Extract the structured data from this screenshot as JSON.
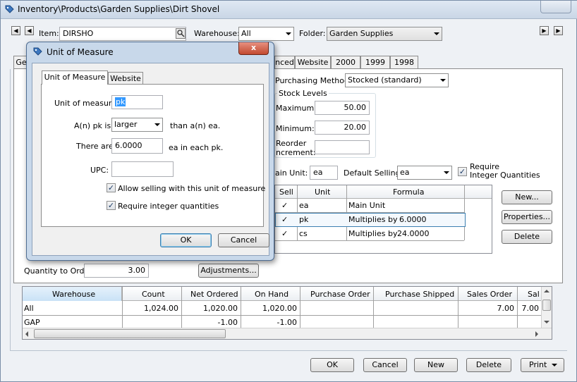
{
  "window": {
    "title": "Inventory\\Products\\Garden Supplies\\Dirt Shovel"
  },
  "header": {
    "item_label": "Item:",
    "item_value": "DIRSHO",
    "warehouse_label": "Warehouse:",
    "warehouse_value": "All",
    "folder_label": "Folder:",
    "folder_value": "Garden Supplies"
  },
  "tabs": [
    {
      "label": "Ge"
    },
    {
      "label": "nced"
    },
    {
      "label": "Website"
    },
    {
      "label": "2000"
    },
    {
      "label": "1999"
    },
    {
      "label": "1998"
    }
  ],
  "purchasing": {
    "method_label": "Purchasing Method:",
    "method_value": "Stocked (standard)"
  },
  "stock_levels": {
    "title": "Stock Levels",
    "maximum_label": "Maximum:",
    "maximum_value": "50.00",
    "minimum_label": "Minimum:",
    "minimum_value": "20.00",
    "reorder_label_1": "Reorder",
    "reorder_label_2": "ncrement:",
    "reorder_value": ""
  },
  "units": {
    "main_unit_label": "ain Unit:",
    "main_unit_value": "ea",
    "default_selling_label": "Default Selling:",
    "default_selling_value": "ea",
    "require_integer_label_1": "Require",
    "require_integer_label_2": "Integer Quantities",
    "require_integer_checked": true,
    "columns": [
      "Sell",
      "Unit",
      "Formula"
    ],
    "rows": [
      {
        "sell": "✓",
        "unit": "ea",
        "formula": "Main Unit",
        "factor": ""
      },
      {
        "sell": "✓",
        "unit": "pk",
        "formula": "Multiplies by",
        "factor": "6.0000"
      },
      {
        "sell": "✓",
        "unit": "cs",
        "formula": "Multiplies by",
        "factor": "24.0000"
      }
    ],
    "new_button": "New...",
    "properties_button": "Properties...",
    "delete_button": "Delete"
  },
  "quantity": {
    "label": "Quantity to Order:",
    "value": "3.00",
    "adjustments_button": "Adjustments..."
  },
  "warehouse_grid": {
    "columns": [
      "Warehouse",
      "Count",
      "Net Ordered",
      "On Hand",
      "Purchase Order",
      "Purchase Shipped",
      "Sales Order",
      "Sal"
    ],
    "rows": [
      {
        "warehouse": "All",
        "count": "1,024.00",
        "net_ordered": "1,020.00",
        "on_hand": "1,020.00",
        "purchase_order": "",
        "purchase_shipped": "",
        "sales_order": "7.00",
        "sal": "7.00"
      },
      {
        "warehouse": "GAP",
        "count": "",
        "net_ordered": "-1.00",
        "on_hand": "-1.00",
        "purchase_order": "",
        "purchase_shipped": "",
        "sales_order": "",
        "sal": ""
      }
    ]
  },
  "footer": {
    "ok": "OK",
    "cancel": "Cancel",
    "new": "New",
    "delete": "Delete",
    "print": "Print"
  },
  "dialog": {
    "title": "Unit of Measure",
    "close": "x",
    "tabs": [
      "Unit of Measure",
      "Website"
    ],
    "uom_label": "Unit of measure:",
    "uom_value": "pk",
    "comparison_prefix": "A(n) pk is",
    "comparison_value": "larger",
    "comparison_suffix": "than a(n) ea.",
    "there_are_label": "There are",
    "there_are_value": "6.0000",
    "there_are_suffix": "ea in each pk.",
    "upc_label": "UPC:",
    "upc_value": "",
    "allow_selling_label": "Allow selling with this unit of measure",
    "allow_selling_checked": true,
    "require_integer_label": "Require integer quantities",
    "require_integer_checked": true,
    "ok": "OK",
    "cancel": "Cancel"
  },
  "colors": {
    "accent": "#3c7fb1",
    "dialog_frame": "#c8d8ea",
    "close_button": "#c24a30"
  }
}
